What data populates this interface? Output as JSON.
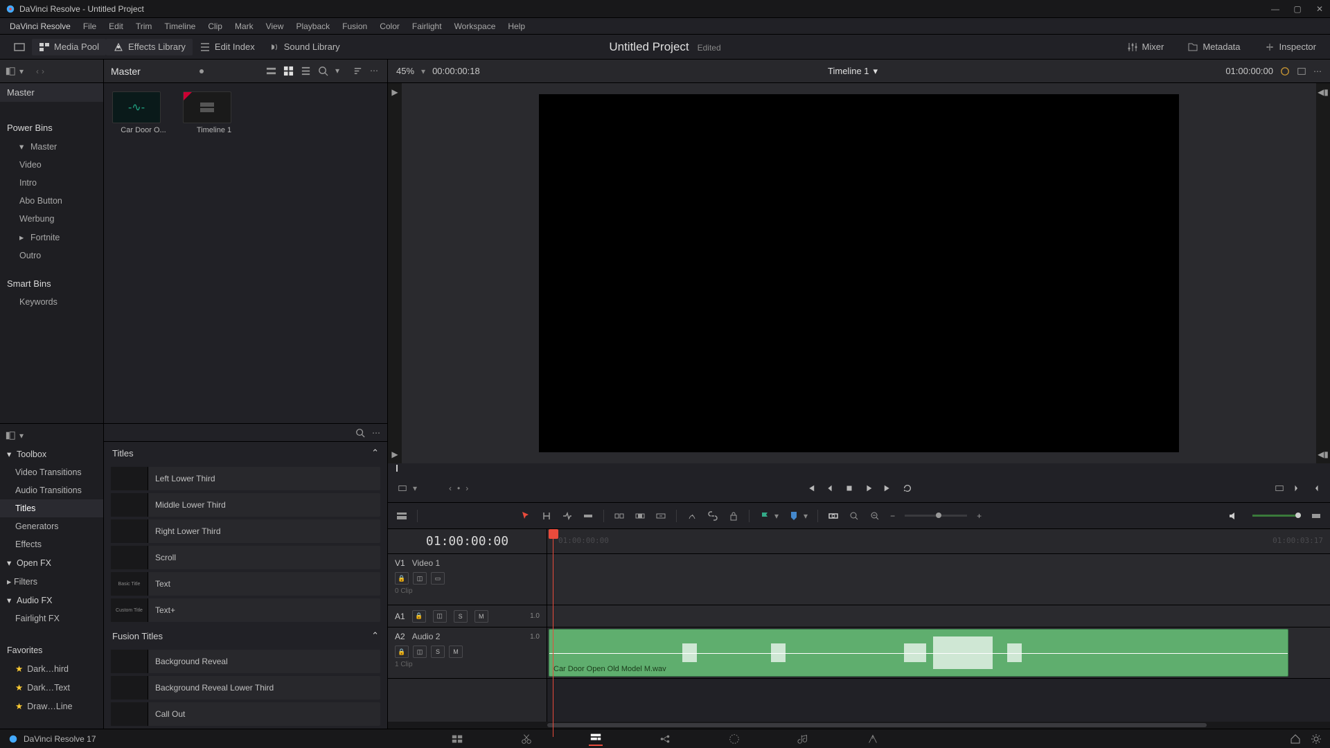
{
  "window": {
    "title": "DaVinci Resolve - Untitled Project"
  },
  "menu": [
    "DaVinci Resolve",
    "File",
    "Edit",
    "Trim",
    "Timeline",
    "Clip",
    "Mark",
    "View",
    "Playback",
    "Fusion",
    "Color",
    "Fairlight",
    "Workspace",
    "Help"
  ],
  "toolbar": {
    "media_pool": "Media Pool",
    "effects_library": "Effects Library",
    "edit_index": "Edit Index",
    "sound_library": "Sound Library",
    "mixer": "Mixer",
    "metadata": "Metadata",
    "inspector": "Inspector"
  },
  "project": {
    "name": "Untitled Project",
    "status": "Edited"
  },
  "pool": {
    "bin_master": "Master",
    "crumb": "Master",
    "section_power": "Power Bins",
    "items": [
      "Video",
      "Intro",
      "Abo Button",
      "Werbung",
      "Fortnite",
      "Outro"
    ],
    "section_smart": "Smart Bins",
    "smart_items": [
      "Keywords"
    ],
    "clips": [
      {
        "name": "Car Door O...",
        "kind": "audio"
      },
      {
        "name": "Timeline 1",
        "kind": "timeline"
      }
    ]
  },
  "fx": {
    "toolbox": "Toolbox",
    "cats": [
      "Video Transitions",
      "Audio Transitions",
      "Titles",
      "Generators",
      "Effects"
    ],
    "openfx": "Open FX",
    "openfx_sub": [
      "Filters"
    ],
    "audiofx": "Audio FX",
    "audiofx_sub": [
      "Fairlight FX"
    ],
    "favorites": "Favorites",
    "fav_items": [
      "Dark…hird",
      "Dark…Text",
      "Draw…Line"
    ],
    "titles_header": "Titles",
    "titles": [
      "Left Lower Third",
      "Middle Lower Third",
      "Right Lower Third",
      "Scroll",
      "Text",
      "Text+"
    ],
    "title_previews": [
      "",
      "",
      "",
      "",
      "Basic Title",
      "Custom Title"
    ],
    "fusion_header": "Fusion Titles",
    "fusion": [
      "Background Reveal",
      "Background Reveal Lower Third",
      "Call Out"
    ]
  },
  "viewer": {
    "zoom": "45%",
    "src_tc": "00:00:00:18",
    "timeline_name": "Timeline 1",
    "rec_tc": "01:00:00:00"
  },
  "timeline": {
    "playhead_tc": "01:00:00:00",
    "ghost_tc_start": "01:00:00:00",
    "ghost_tc_end": "01:00:03:17",
    "tracks": {
      "v1": {
        "id": "V1",
        "name": "Video 1",
        "clips": "0 Clip"
      },
      "a1": {
        "id": "A1",
        "ch": "1.0"
      },
      "a2": {
        "id": "A2",
        "name": "Audio 2",
        "ch": "1.0",
        "clips": "1 Clip"
      }
    },
    "audio_clip_name": "Car Door Open Old Model M.wav"
  },
  "footer": {
    "app": "DaVinci Resolve 17"
  }
}
